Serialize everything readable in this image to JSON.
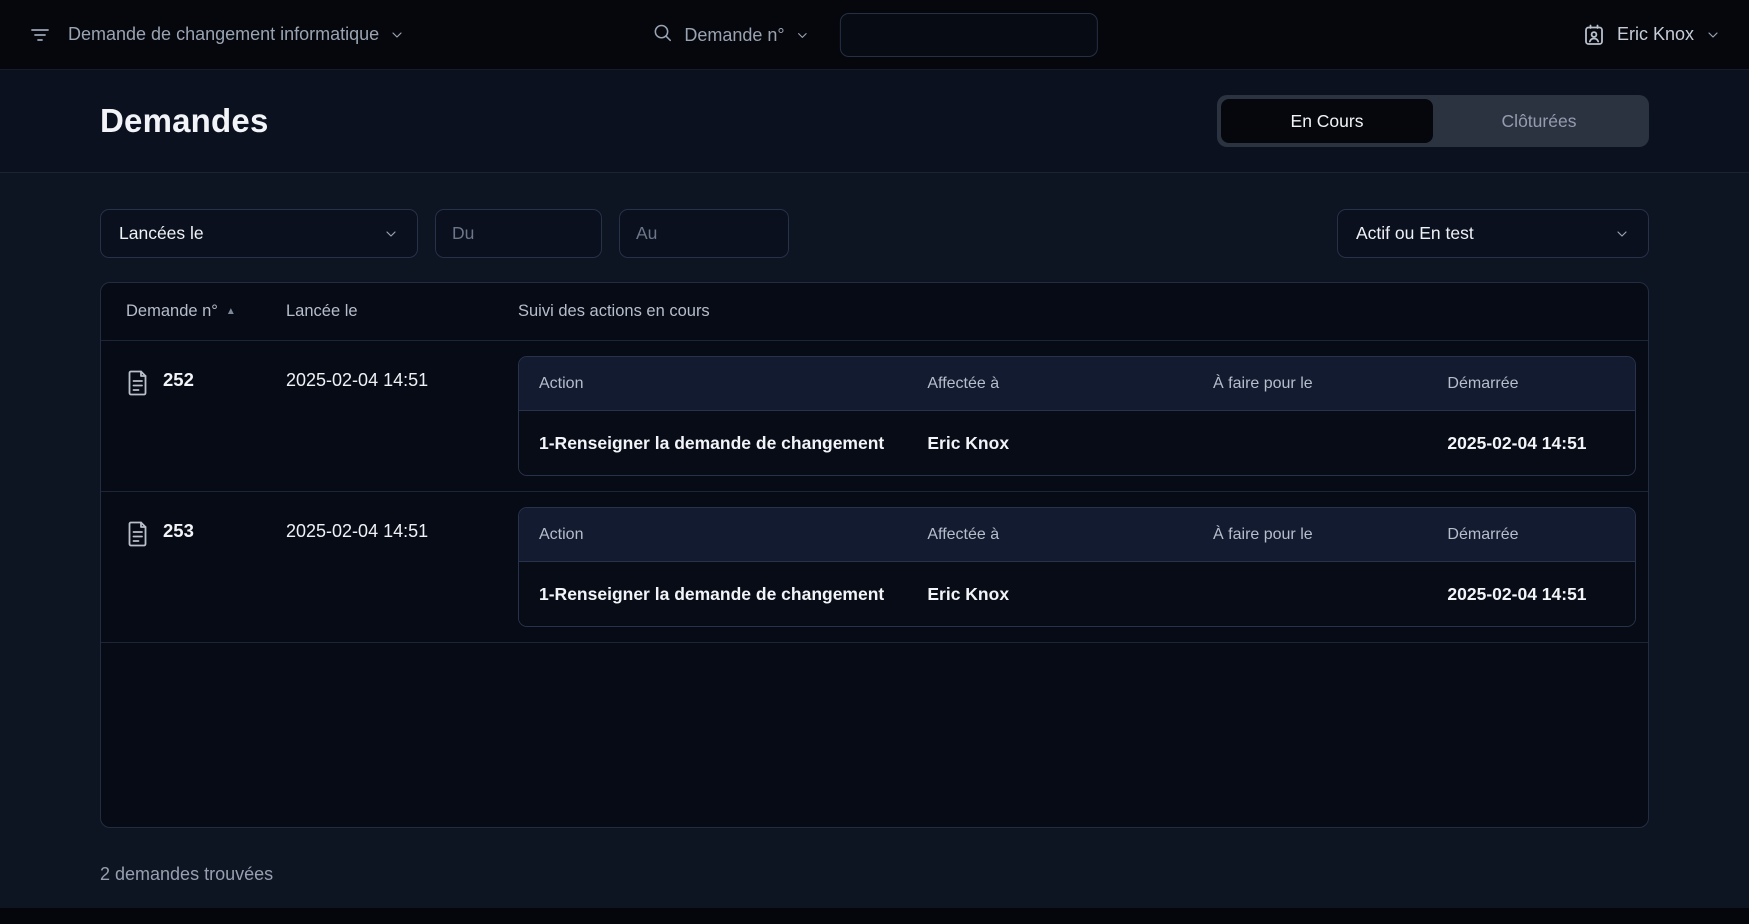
{
  "topbar": {
    "app_title": "Demande de changement informatique",
    "search_label": "Demande n°",
    "search_value": "",
    "user_name": "Eric Knox"
  },
  "header": {
    "title": "Demandes",
    "tabs": [
      {
        "label": "En Cours",
        "active": true
      },
      {
        "label": "Clôturées",
        "active": false
      }
    ]
  },
  "filters": {
    "date_field_label": "Lancées le",
    "du_placeholder": "Du",
    "au_placeholder": "Au",
    "status_label": "Actif ou En test"
  },
  "table": {
    "col_demande": "Demande n°",
    "sort_indicator": "▲",
    "col_lancee": "Lancée le",
    "col_suivi": "Suivi des actions en cours",
    "action_cols": {
      "action": "Action",
      "affectee": "Affectée à",
      "afaire": "À faire pour le",
      "demarree": "Démarrée"
    },
    "rows": [
      {
        "number": "252",
        "launched": "2025-02-04 14:51",
        "actions": [
          {
            "action": "1-Renseigner la demande de changement",
            "assigned_to": "Eric Knox",
            "due": "",
            "started": "2025-02-04 14:51"
          }
        ]
      },
      {
        "number": "253",
        "launched": "2025-02-04 14:51",
        "actions": [
          {
            "action": "1-Renseigner la demande de changement",
            "assigned_to": "Eric Knox",
            "due": "",
            "started": "2025-02-04 14:51"
          }
        ]
      }
    ]
  },
  "footer": {
    "count": "2 demandes trouvées"
  },
  "colors": {
    "topbar_bg": "#05070c",
    "page_bg": "#0d1422",
    "card_bg": "#070b15",
    "card_border": "#232d42",
    "nested_header_bg": "#121b2f",
    "tab_container_bg": "#2c3340",
    "active_tab_bg": "#05070d",
    "text_primary": "#f2f4f8",
    "text_muted": "#97a0b0"
  }
}
